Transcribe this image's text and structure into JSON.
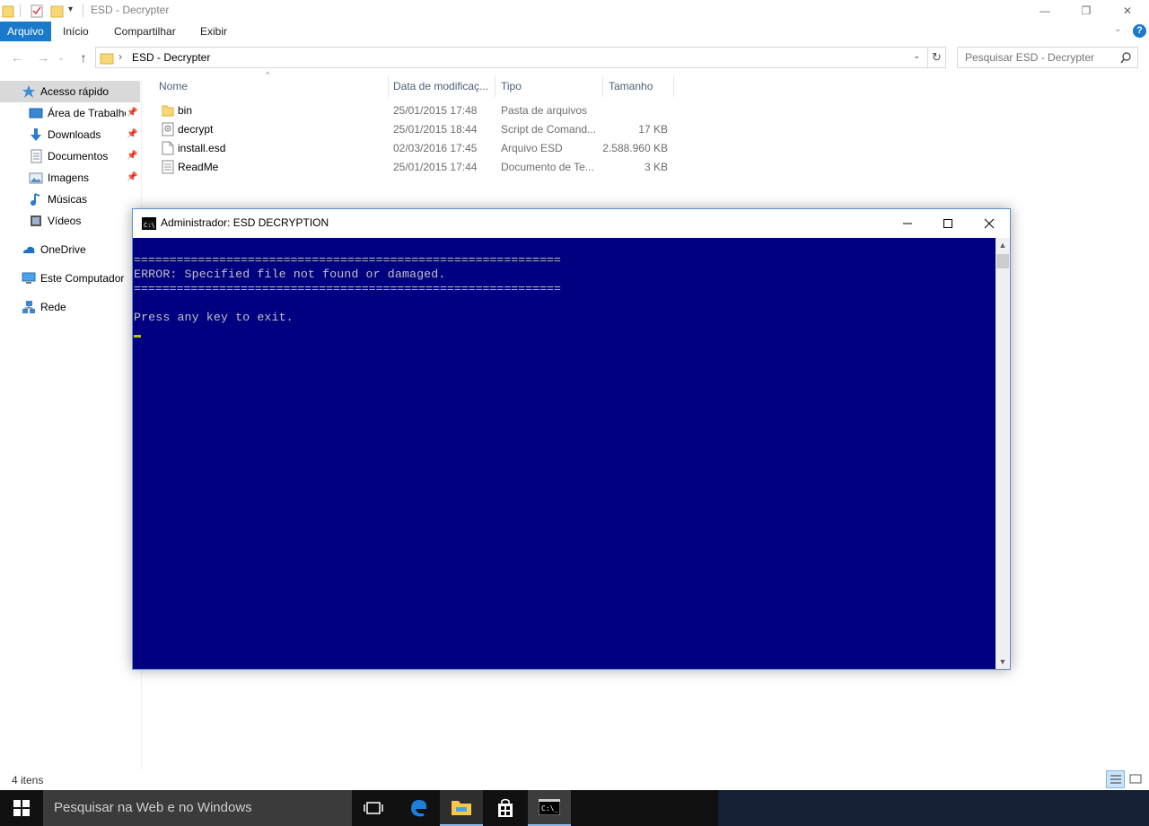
{
  "window": {
    "title": "ESD - Decrypter",
    "minimize": "—",
    "restore": "❐",
    "close": "✕"
  },
  "ribbon": {
    "tabs": [
      "Arquivo",
      "Início",
      "Compartilhar",
      "Exibir"
    ],
    "help": "?"
  },
  "address": {
    "path": "ESD - Decrypter",
    "separator": "›",
    "search_placeholder": "Pesquisar ESD - Decrypter"
  },
  "navpane": {
    "items": [
      {
        "label": "Acesso rápido",
        "icon": "star-icon"
      },
      {
        "label": "Área de Trabalho",
        "icon": "desktop-icon",
        "pinned": true
      },
      {
        "label": "Downloads",
        "icon": "download-icon",
        "pinned": true
      },
      {
        "label": "Documentos",
        "icon": "documents-icon",
        "pinned": true
      },
      {
        "label": "Imagens",
        "icon": "pictures-icon",
        "pinned": true
      },
      {
        "label": "Músicas",
        "icon": "music-icon"
      },
      {
        "label": "Vídeos",
        "icon": "videos-icon"
      },
      {
        "label": "OneDrive",
        "icon": "onedrive-icon"
      },
      {
        "label": "Este Computador",
        "icon": "computer-icon"
      },
      {
        "label": "Rede",
        "icon": "network-icon"
      }
    ]
  },
  "filelist": {
    "columns": [
      "Nome",
      "Data de modificaç...",
      "Tipo",
      "Tamanho"
    ],
    "rows": [
      {
        "name": "bin",
        "date": "25/01/2015 17:48",
        "type": "Pasta de arquivos",
        "size": "",
        "icon": "folder-icon"
      },
      {
        "name": "decrypt",
        "date": "25/01/2015 18:44",
        "type": "Script de Comand...",
        "size": "17 KB",
        "icon": "script-icon"
      },
      {
        "name": "install.esd",
        "date": "02/03/2016 17:45",
        "type": "Arquivo ESD",
        "size": "2.588.960 KB",
        "icon": "file-icon"
      },
      {
        "name": "ReadMe",
        "date": "25/01/2015 17:44",
        "type": "Documento de Te...",
        "size": "3 KB",
        "icon": "text-file-icon"
      }
    ]
  },
  "status": {
    "count": "4 itens"
  },
  "console": {
    "title": "Administrador:  ESD DECRYPTION",
    "lines": [
      "============================================================",
      "ERROR: Specified file not found or damaged.",
      "============================================================",
      "",
      "Press any key to exit."
    ]
  },
  "taskbar": {
    "search_text": "Pesquisar na Web e no Windows"
  },
  "colors": {
    "accent": "#1979ca",
    "console_bg": "#000080",
    "console_fg": "#c0c0c0",
    "taskbar": "#101010"
  }
}
